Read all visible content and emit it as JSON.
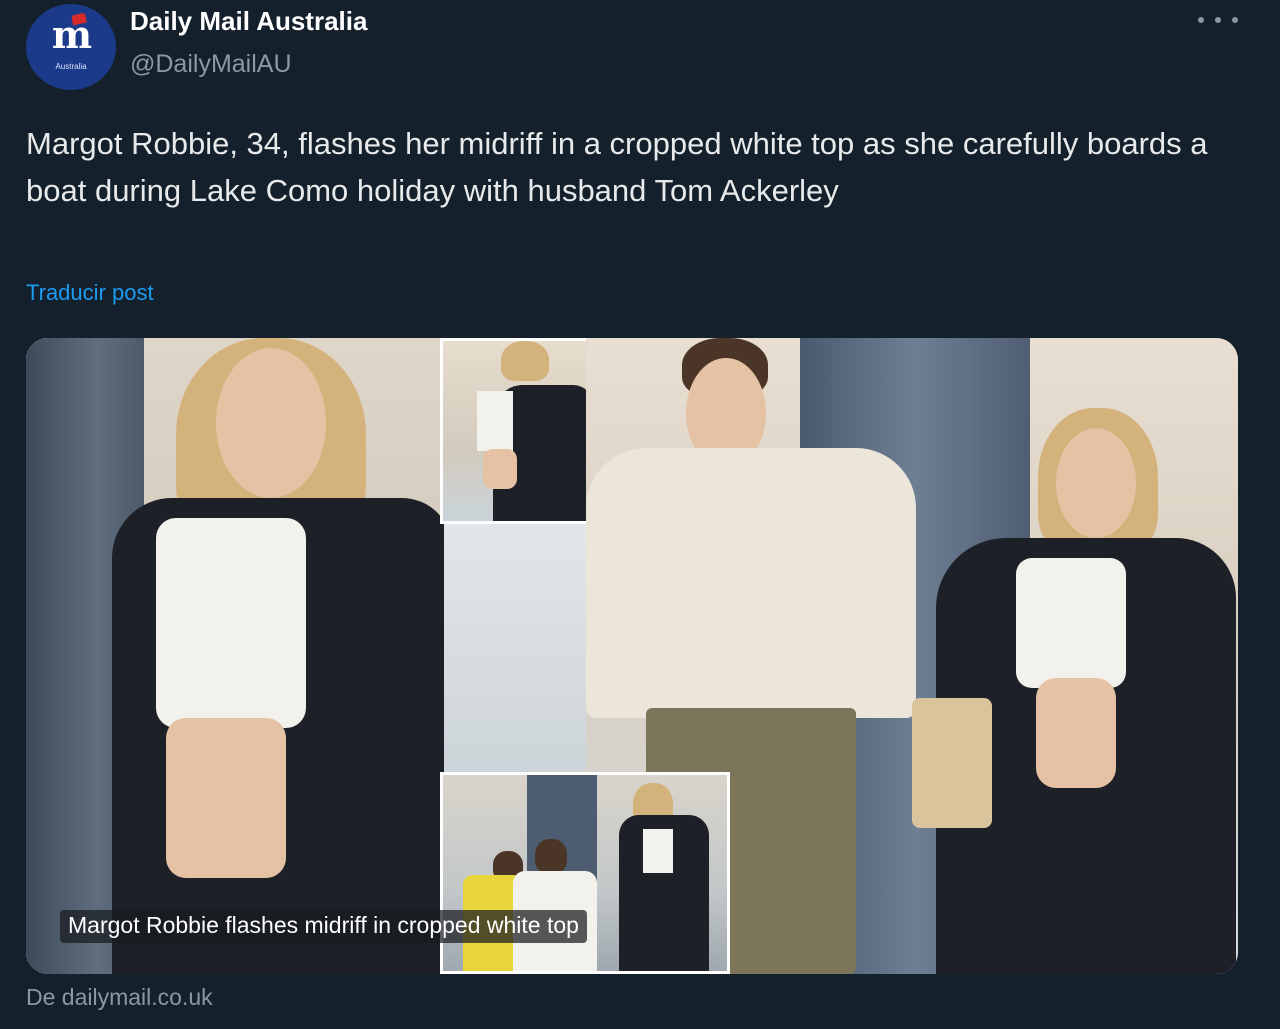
{
  "account": {
    "display_name": "Daily Mail Australia",
    "handle": "@DailyMailAU",
    "avatar_text": "m",
    "avatar_subtext": "Australia"
  },
  "post": {
    "text": "Margot Robbie, 34, flashes her midriff in a cropped white top as she carefully boards a boat during Lake Como holiday with husband Tom Ackerley",
    "translate_label": "Traducir post"
  },
  "media": {
    "caption": "Margot Robbie flashes midriff in cropped white top"
  },
  "link": {
    "source_label": "De dailymail.co.uk"
  },
  "icons": {
    "more": "more-options-icon"
  },
  "colors": {
    "background": "#15202b",
    "text": "#e7e9ea",
    "secondary": "#8b98a5",
    "link": "#1d9bf0",
    "avatar": "#1b3a8a"
  }
}
